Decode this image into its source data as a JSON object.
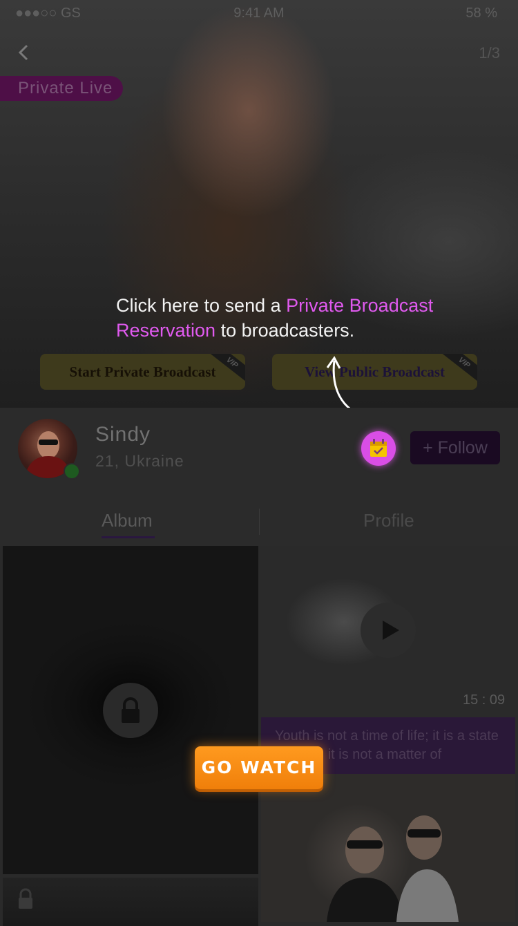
{
  "status_bar": {
    "carrier": "●●●○○ GS",
    "time": "9:41 AM",
    "battery": "58 %"
  },
  "header": {
    "back_icon": "chevron-left-icon",
    "page_indicator": "1/3"
  },
  "badge": {
    "private_live": "Private Live"
  },
  "hero_buttons": {
    "start_private": "Start Private Broadcast",
    "view_public": "View Public Broadcast",
    "vip_tag": "VIP"
  },
  "tip": {
    "prefix": "Click here to send a ",
    "highlight_1": "Private Broadcast",
    "highlight_2": "Reservation",
    "suffix": " to broadcasters."
  },
  "user": {
    "name": "Sindy",
    "meta": "21, Ukraine",
    "online": true
  },
  "actions": {
    "reserve_icon": "calendar-check-icon",
    "follow_label": "+ Follow"
  },
  "tabs": [
    {
      "label": "Album",
      "active": true
    },
    {
      "label": "Profile",
      "active": false
    }
  ],
  "media": {
    "video_duration": "15 : 09",
    "quote": "Youth is not a time of life; it is a state of mind; it is not a matter of"
  },
  "cta": {
    "go_watch": "GO WATCH"
  },
  "colors": {
    "accent": "#e05aef",
    "cta": "#ff9a1f",
    "reserve": "#d94ee6"
  }
}
